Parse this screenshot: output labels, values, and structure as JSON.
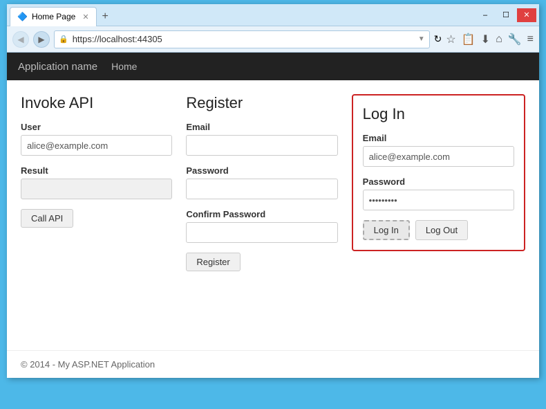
{
  "window": {
    "title": "Home Page",
    "url": "https://localhost:44305",
    "controls": {
      "minimize": "–",
      "maximize": "☐",
      "close": "✕"
    }
  },
  "nav": {
    "app_name": "Application name",
    "links": [
      "Home"
    ]
  },
  "invoke_api": {
    "title": "Invoke API",
    "user_label": "User",
    "user_value": "alice@example.com",
    "result_label": "Result",
    "result_value": "",
    "call_api_label": "Call API"
  },
  "register": {
    "title": "Register",
    "email_label": "Email",
    "email_value": "",
    "password_label": "Password",
    "password_value": "",
    "confirm_password_label": "Confirm Password",
    "confirm_password_value": "",
    "register_label": "Register"
  },
  "login": {
    "title": "Log In",
    "email_label": "Email",
    "email_value": "alice@example.com",
    "password_label": "Password",
    "password_value": "••••••••",
    "login_label": "Log In",
    "logout_label": "Log Out"
  },
  "footer": {
    "text": "© 2014 - My ASP.NET Application"
  },
  "toolbar": {
    "star": "☆",
    "clipboard": "📋",
    "download": "⬇",
    "home": "⌂",
    "refresh": "↻",
    "menu": "≡"
  }
}
